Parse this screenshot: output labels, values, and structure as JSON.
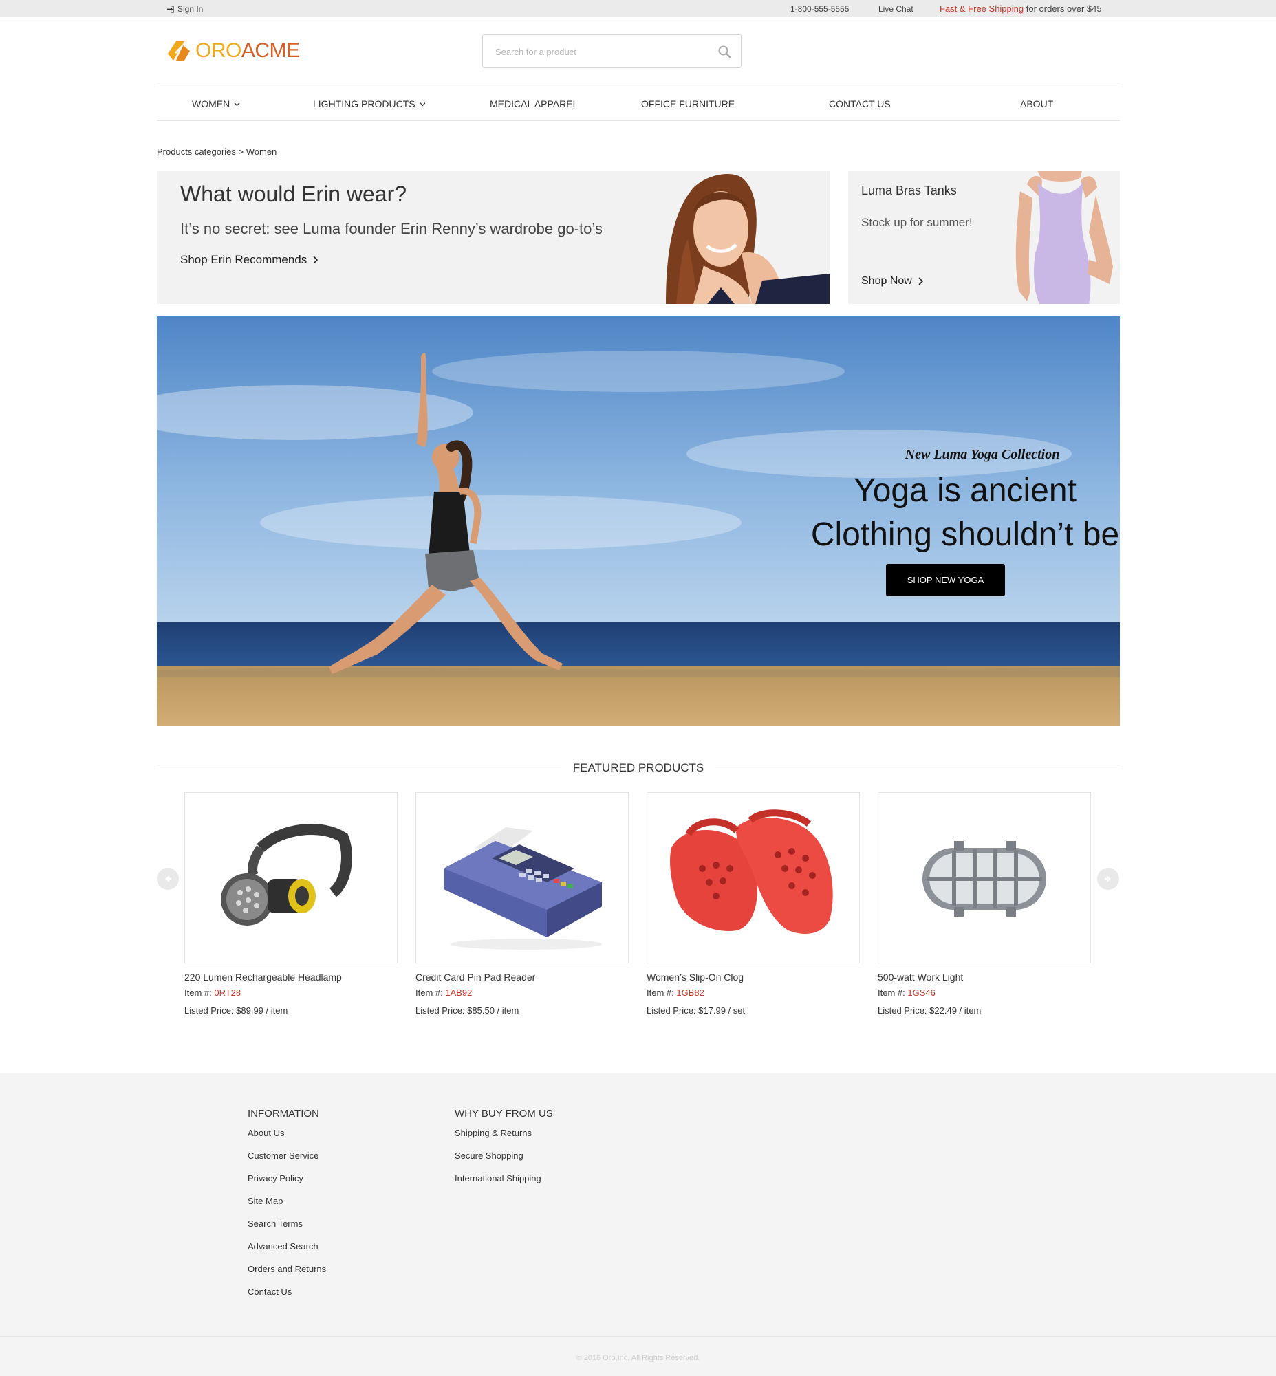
{
  "topbar": {
    "signin": "Sign In",
    "phone": "1-800-555-5555",
    "chat": "Live Chat",
    "shipping_accent": "Fast & Free Shipping",
    "shipping_rest": " for orders over $45"
  },
  "header": {
    "logo_oro": "ORO",
    "logo_acme": "ACME",
    "search_placeholder": "Search for a product"
  },
  "nav": [
    {
      "label": "Women",
      "dropdown": true
    },
    {
      "label": "Lighting Products",
      "dropdown": true
    },
    {
      "label": "Medical Apparel",
      "dropdown": false
    },
    {
      "label": "Office Furniture",
      "dropdown": false
    },
    {
      "label": "Contact Us",
      "dropdown": false
    },
    {
      "label": "About",
      "dropdown": false
    }
  ],
  "breadcrumb": {
    "root": "Products categories",
    "sep": " > ",
    "current": "Women"
  },
  "promo_main": {
    "title": "What would Erin wear?",
    "subtitle": "It’s no secret: see Luma founder Erin Renny’s wardrobe go-to’s",
    "link": "Shop Erin Recommends"
  },
  "promo_side": {
    "title": "Luma Bras Tanks",
    "subtitle": "Stock up for summer!",
    "link": "Shop Now"
  },
  "hero": {
    "kicker": "New Luma Yoga Collection",
    "line1": "Yoga is ancient",
    "line2": "Clothing shouldn’t be",
    "button": "Shop New Yoga"
  },
  "featured": {
    "heading": "Featured Products",
    "item_label": "Item #: ",
    "price_label": "Listed Price: ",
    "products": [
      {
        "name": "220 Lumen Rechargeable Headlamp",
        "code": "0RT28",
        "price": "$89.99 / item",
        "icon": "headlamp-icon"
      },
      {
        "name": "Credit Card Pin Pad Reader",
        "code": "1AB92",
        "price": "$85.50 / item",
        "icon": "card-reader-icon"
      },
      {
        "name": "Women’s Slip-On Clog",
        "code": "1GB82",
        "price": "$17.99 / set",
        "icon": "clog-icon"
      },
      {
        "name": "500-watt Work Light",
        "code": "1GS46",
        "price": "$22.49 / item",
        "icon": "work-light-icon"
      }
    ]
  },
  "footer": {
    "info_heading": "Information",
    "info_links": [
      "About Us",
      "Customer Service",
      "Privacy Policy",
      "Site Map",
      "Search Terms",
      "Advanced Search",
      "Orders and Returns",
      "Contact Us"
    ],
    "why_heading": "Why Buy From Us",
    "why_links": [
      "Shipping & Returns",
      "Secure Shopping",
      "International Shipping"
    ],
    "copyright": "© 2016 Oro,Inc. All Rights Reserved."
  },
  "colors": {
    "accent_red": "#c0392b",
    "logo_orange": "#f2a81b",
    "logo_dark_orange": "#d95f24",
    "topbar_bg": "#ebebeb",
    "footer_bg": "#f4f4f4"
  }
}
